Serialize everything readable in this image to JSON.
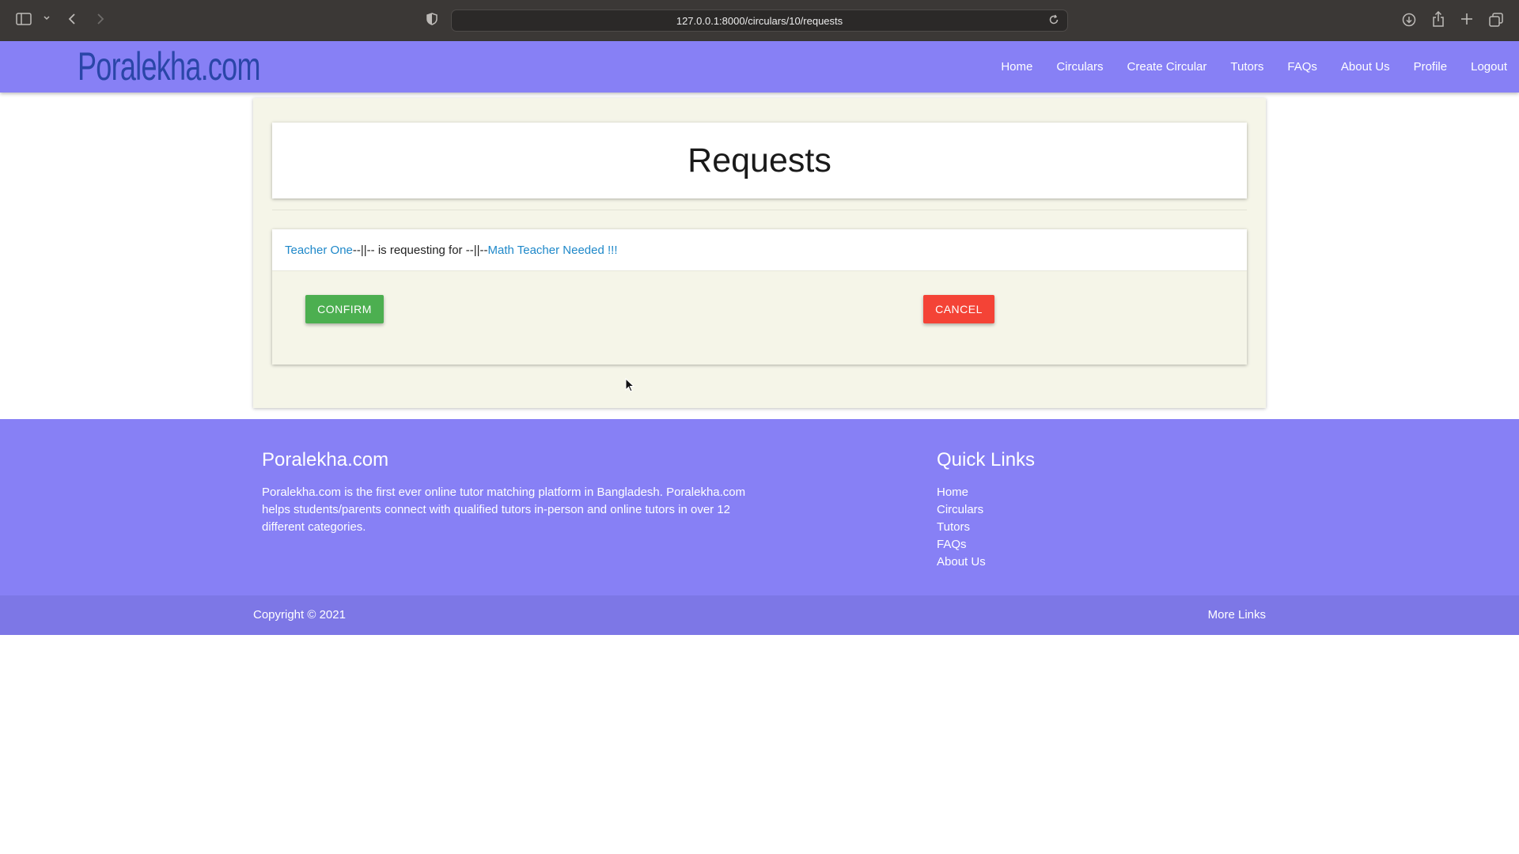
{
  "browser": {
    "url": "127.0.0.1:8000/circulars/10/requests",
    "icons": [
      "sidebar-icon",
      "chevron-down-icon",
      "back-icon",
      "forward-icon",
      "shield-icon",
      "reload-icon",
      "download-icon",
      "share-icon",
      "new-tab-icon",
      "tabs-icon"
    ]
  },
  "navbar": {
    "logo": "Poralekha.com",
    "links": [
      "Home",
      "Circulars",
      "Create Circular",
      "Tutors",
      "FAQs",
      "About Us",
      "Profile",
      "Logout"
    ]
  },
  "page": {
    "title": "Requests",
    "request": {
      "teacher": "Teacher One",
      "middle_text": "--||-- is requesting for --||--",
      "circular": "Math Teacher Needed !!!"
    },
    "confirm_label": "CONFIRM",
    "cancel_label": "CANCEL"
  },
  "footer": {
    "brand": "Poralekha.com",
    "description": "Poralekha.com is the first ever online tutor matching platform in Bangladesh. Poralekha.com helps students/parents connect with qualified tutors in-person and online tutors in over 12 different categories.",
    "quick_links_title": "Quick Links",
    "quick_links": [
      "Home",
      "Circulars",
      "Tutors",
      "FAQs",
      "About Us"
    ],
    "copyright": "Copyright © 2021",
    "more_links": "More Links"
  },
  "colors": {
    "navbar": "#8780f5",
    "card_bg": "#f5f5e8",
    "confirm": "#4caf50",
    "cancel": "#f44336",
    "link": "#1e88c9"
  }
}
